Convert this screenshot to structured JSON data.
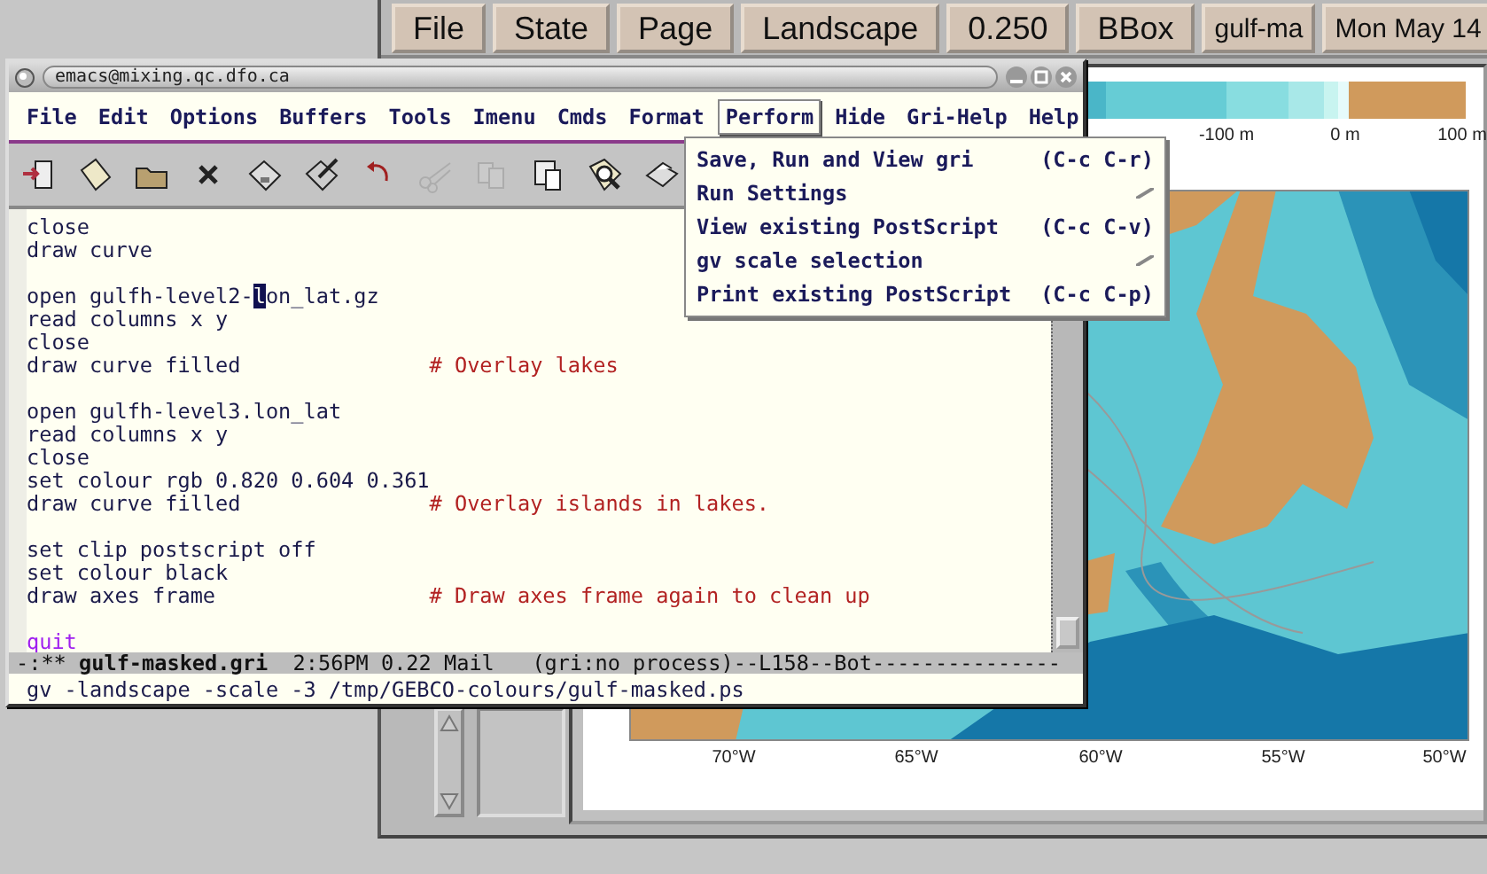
{
  "viewer": {
    "buttons": [
      {
        "label": "File",
        "kind": "button"
      },
      {
        "label": "State",
        "kind": "button"
      },
      {
        "label": "Page",
        "kind": "button"
      },
      {
        "label": "Landscape",
        "kind": "button"
      },
      {
        "label": "0.250",
        "kind": "button"
      },
      {
        "label": "BBox",
        "kind": "button"
      },
      {
        "label": "gulf-ma",
        "kind": "info"
      },
      {
        "label": "Mon May 14",
        "kind": "info"
      }
    ],
    "scale_labels": [
      "-100 m",
      "0 m",
      "100 m"
    ],
    "axis_labels": [
      "70°W",
      "65°W",
      "60°W",
      "55°W",
      "50°W"
    ]
  },
  "emacs": {
    "title": "emacs@mixing.qc.dfo.ca",
    "menu": [
      {
        "label": "File",
        "selected": false
      },
      {
        "label": "Edit",
        "selected": false
      },
      {
        "label": "Options",
        "selected": false
      },
      {
        "label": "Buffers",
        "selected": false
      },
      {
        "label": "Tools",
        "selected": false
      },
      {
        "label": "Imenu",
        "selected": false
      },
      {
        "label": "Cmds",
        "selected": false
      },
      {
        "label": "Format",
        "selected": false
      },
      {
        "label": "Perform",
        "selected": true
      },
      {
        "label": "Hide",
        "selected": false
      },
      {
        "label": "Gri-Help",
        "selected": false
      },
      {
        "label": "Help",
        "selected": false
      }
    ],
    "toolbar": [
      {
        "kind": "exit",
        "disabled": false
      },
      {
        "kind": "new",
        "disabled": false
      },
      {
        "kind": "open",
        "disabled": false
      },
      {
        "kind": "close",
        "disabled": false
      },
      {
        "kind": "save",
        "disabled": false
      },
      {
        "kind": "saveas",
        "disabled": false
      },
      {
        "kind": "undo",
        "disabled": false
      },
      {
        "kind": "cut",
        "disabled": true
      },
      {
        "kind": "copy",
        "disabled": true
      },
      {
        "kind": "paste",
        "disabled": false
      },
      {
        "kind": "find",
        "disabled": false
      },
      {
        "kind": "print",
        "disabled": false
      }
    ],
    "lines": [
      {
        "kind": "code",
        "text": "close"
      },
      {
        "kind": "code",
        "text": "draw curve"
      },
      {
        "kind": "blank"
      },
      {
        "kind": "cursor",
        "text": "open gulfh-level2-",
        "cursor": "l",
        "rest": "on_lat.gz"
      },
      {
        "kind": "code",
        "text": "read columns x y"
      },
      {
        "kind": "code",
        "text": "close"
      },
      {
        "kind": "code",
        "text": "draw curve filled",
        "comment": "# Overlay lakes"
      },
      {
        "kind": "blank"
      },
      {
        "kind": "code",
        "text": "open gulfh-level3.lon_lat"
      },
      {
        "kind": "code",
        "text": "read columns x y"
      },
      {
        "kind": "code",
        "text": "close"
      },
      {
        "kind": "code",
        "text": "set colour rgb 0.820 0.604 0.361"
      },
      {
        "kind": "code",
        "text": "draw curve filled",
        "comment": "# Overlay islands in lakes."
      },
      {
        "kind": "blank"
      },
      {
        "kind": "code",
        "text": "set clip postscript off"
      },
      {
        "kind": "code",
        "text": "set colour black"
      },
      {
        "kind": "code",
        "text": "draw axes frame",
        "comment": "# Draw axes frame again to clean up"
      },
      {
        "kind": "blank"
      },
      {
        "kind": "keyword",
        "text": "quit"
      }
    ],
    "mode_line": {
      "flags": "-:**",
      "buffer": "gulf-masked.gri",
      "info": "2:56PM 0.22 Mail   (gri:no process)--L158--Bot---------------"
    },
    "minibuffer": "gv -landscape -scale -3 /tmp/GEBCO-colours/gulf-masked.ps",
    "perform_menu": [
      {
        "kind": "command",
        "label": "Save, Run and View gri",
        "shortcut": "(C-c C-r)"
      },
      {
        "kind": "submenu",
        "label": "Run Settings"
      },
      {
        "kind": "command",
        "label": "View existing PostScript",
        "shortcut": "(C-c C-v)"
      },
      {
        "kind": "submenu",
        "label": "gv scale selection"
      },
      {
        "kind": "command",
        "label": "Print existing PostScript",
        "shortcut": "(C-c C-p)"
      }
    ]
  }
}
